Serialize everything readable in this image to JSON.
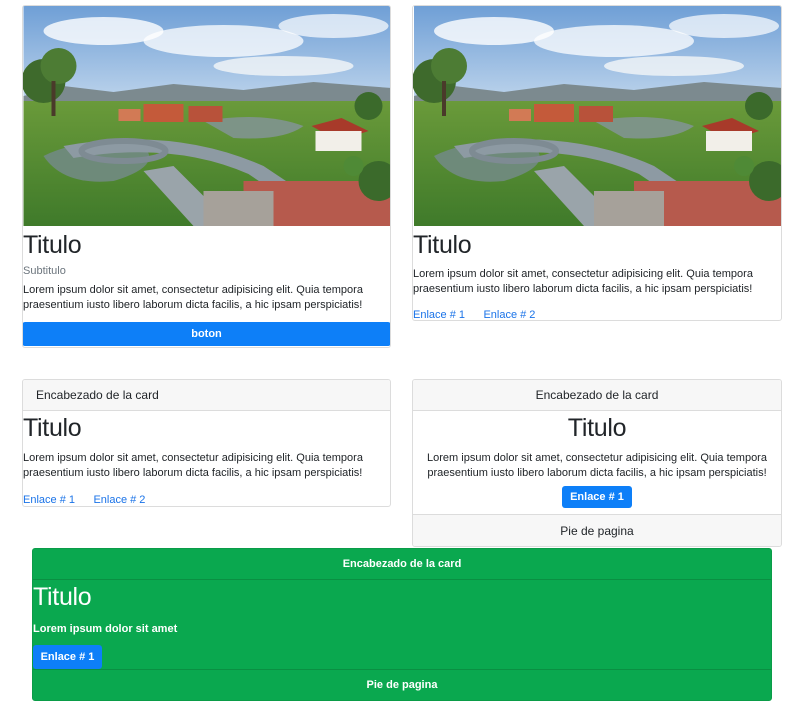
{
  "card1": {
    "image_alt": "Aerial campus photo",
    "title": "Titulo",
    "subtitle": "Subtitulo",
    "text": "Lorem ipsum dolor sit amet, consectetur adipisicing elit. Quia tempora praesentium iusto libero laborum dicta facilis, a hic ipsam perspiciatis!",
    "button": "boton"
  },
  "card2": {
    "image_alt": "Aerial campus photo",
    "title": "Titulo",
    "text": "Lorem ipsum dolor sit amet, consectetur adipisicing elit. Quia tempora praesentium iusto libero laborum dicta facilis, a hic ipsam perspiciatis!",
    "link1": "Enlace # 1",
    "link2": "Enlace # 2"
  },
  "card3": {
    "header": "Encabezado de la card",
    "title": "Titulo",
    "text": "Lorem ipsum dolor sit amet, consectetur adipisicing elit. Quia tempora praesentium iusto libero laborum dicta facilis, a hic ipsam perspiciatis!",
    "link1": "Enlace # 1",
    "link2": "Enlace # 2"
  },
  "card4": {
    "header": "Encabezado de la card",
    "title": "Titulo",
    "text": "Lorem ipsum dolor sit amet, consectetur adipisicing elit. Quia tempora praesentium iusto libero laborum dicta facilis, a hic ipsam perspiciatis!",
    "button": "Enlace # 1",
    "footer": "Pie de pagina"
  },
  "card5": {
    "header": "Encabezado de la card",
    "title": "Titulo",
    "text": "Lorem ipsum dolor sit amet",
    "button": "Enlace # 1",
    "footer": "Pie de pagina"
  },
  "colors": {
    "primary": "#0d7ff8",
    "success": "#0aa84f",
    "link": "#1a73e8"
  }
}
